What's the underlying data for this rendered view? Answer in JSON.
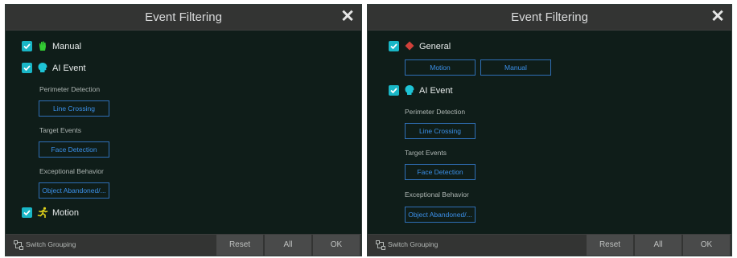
{
  "left_panel": {
    "title": "Event Filtering",
    "categories": [
      {
        "label": "Manual",
        "checked": true,
        "icon": "hand-icon",
        "color": "#33cc33"
      },
      {
        "label": "AI Event",
        "checked": true,
        "icon": "ai-head-icon",
        "color": "#1ec4d6"
      },
      {
        "label": "Motion",
        "checked": true,
        "icon": "running-person-icon",
        "color": "#e0d21a"
      }
    ],
    "sections": [
      {
        "label": "Perimeter Detection",
        "button": "Line Crossing"
      },
      {
        "label": "Target Events",
        "button": "Face Detection"
      },
      {
        "label": "Exceptional Behavior",
        "button": "Object Abandoned/..."
      }
    ],
    "footer": {
      "switch_grouping": "Switch Grouping",
      "reset": "Reset",
      "all": "All",
      "ok": "OK"
    }
  },
  "right_panel": {
    "title": "Event Filtering",
    "categories": [
      {
        "label": "General",
        "checked": true,
        "icon": "diamond-icon",
        "color": "#d0413a"
      },
      {
        "label": "AI Event",
        "checked": true,
        "icon": "ai-head-icon",
        "color": "#1ec4d6"
      }
    ],
    "general_buttons": [
      "Motion",
      "Manual"
    ],
    "sections": [
      {
        "label": "Perimeter Detection",
        "button": "Line Crossing"
      },
      {
        "label": "Target Events",
        "button": "Face Detection"
      },
      {
        "label": "Exceptional Behavior",
        "button": "Object Abandoned/..."
      }
    ],
    "footer": {
      "switch_grouping": "Switch Grouping",
      "reset": "Reset",
      "all": "All",
      "ok": "OK"
    }
  }
}
